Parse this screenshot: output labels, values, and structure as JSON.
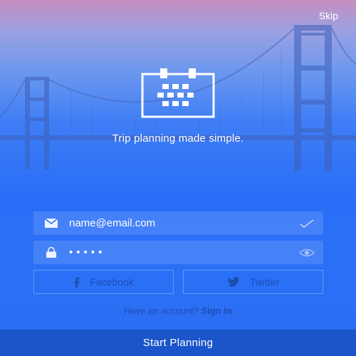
{
  "header": {
    "skip_label": "Skip"
  },
  "hero": {
    "tagline": "Trip planning made simple."
  },
  "form": {
    "email_value": "name@email.com",
    "password_mask": "•••••"
  },
  "social": {
    "facebook_label": "Facebook",
    "twitter_label": "Twitter"
  },
  "account": {
    "prompt": "Have an account?",
    "signin_label": "Sign In"
  },
  "cta": {
    "label": "Start Planning"
  },
  "icons": {
    "calendar": "calendar-icon",
    "email": "envelope-icon",
    "password": "lock-icon",
    "email_valid": "checkmark-icon",
    "reveal": "eye-icon",
    "facebook": "facebook-icon",
    "twitter": "twitter-icon"
  },
  "colors": {
    "accent": "#2a6ef7",
    "cta_background": "#1a55c9"
  }
}
